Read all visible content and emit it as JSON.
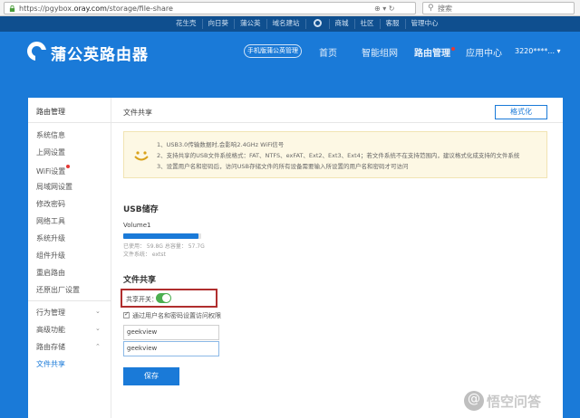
{
  "browser": {
    "url_prefix": "https://pgybox.",
    "url_host": "oray.com",
    "url_path": "/storage/file-share",
    "nav_glyphs": "⊕ ▾ ↻",
    "search_placeholder": "搜索"
  },
  "top_links": [
    "花生壳",
    "向日葵",
    "蒲公英",
    "域名建站",
    "商城",
    "社区",
    "客服",
    "管理中心"
  ],
  "header": {
    "logo": "蒲公英路由器",
    "mobile_button": "手机版蒲公英管理",
    "nav": [
      "首页",
      "智能组网",
      "路由管理",
      "应用中心"
    ],
    "active_nav": "路由管理",
    "user": "3220****..."
  },
  "sidebar": {
    "title": "路由管理",
    "items": [
      "系统信息",
      "上网设置",
      "WiFi设置",
      "局域网设置",
      "修改密码",
      "网络工具",
      "系统升级",
      "组件升级",
      "重启路由",
      "还原出厂设置"
    ],
    "groups": [
      "行为管理",
      "高级功能",
      "路由存储"
    ],
    "active_item": "文件共享"
  },
  "main": {
    "page_title": "文件共享",
    "format_button": "格式化",
    "notice": [
      "1、USB3.0传输数据时,会影响2.4GHz WiFi信号",
      "2、支持共享的USB文件系统格式：FAT、NTFS、exFAT、Ext2、Ext3、Ext4；若文件系统不在支持范围内，建议格式化成支持的文件系统",
      "3、设置用户名和密码后，访问USB存储文件的所有设备需要输入所设置的用户名和密码才可访问"
    ],
    "usb_title": "USB储存",
    "volume_name": "Volume1",
    "volume_used_fraction": 0.96,
    "volume_info": [
      "已使用：  59.8G   总容量：  57.7G",
      "文件系统：  extst"
    ],
    "share_title": "文件共享",
    "switch_label": "共享开关：",
    "checkbox_label": "通过用户名和密码设置访问权限",
    "username": "geekview",
    "password": "geekview",
    "save_button": "保存"
  },
  "watermark": "悟空问答"
}
